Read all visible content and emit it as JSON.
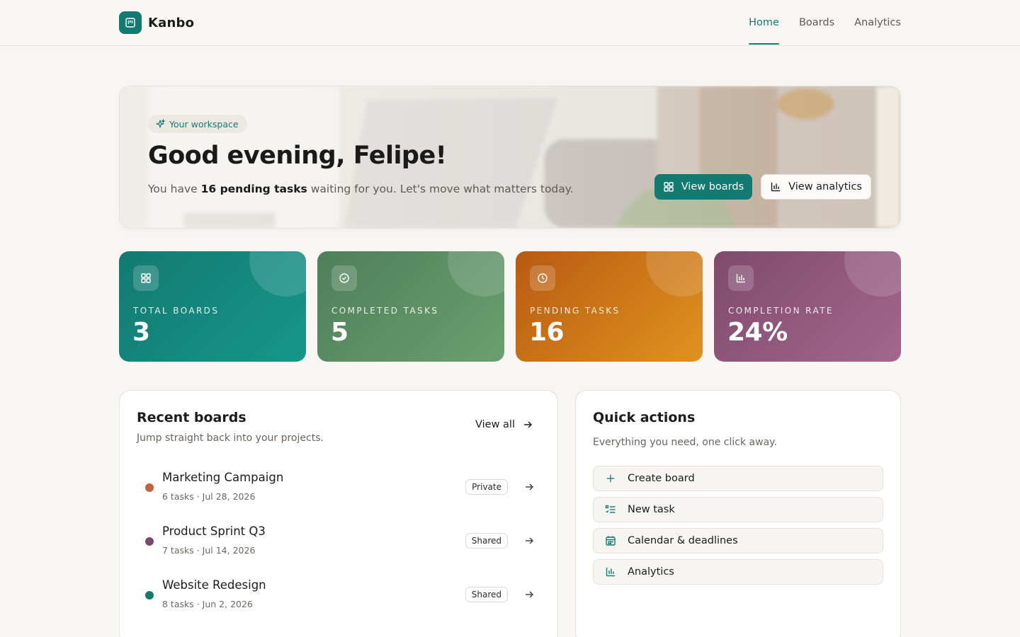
{
  "brand": {
    "name": "Kanbo",
    "logo_icon": "kanban-board-icon",
    "accent": "#137a72"
  },
  "nav": {
    "items": [
      {
        "label": "Home",
        "active": true
      },
      {
        "label": "Boards",
        "active": false
      },
      {
        "label": "Analytics",
        "active": false
      }
    ]
  },
  "hero": {
    "pill": "Your workspace",
    "pill_icon": "sparkles-icon",
    "title": "Good evening, Felipe!",
    "sub_prefix": "You have ",
    "sub_bold": "16 pending tasks",
    "sub_suffix": " waiting for you. Let's move what matters today.",
    "primary_button": {
      "label": "View boards",
      "icon": "grid-icon"
    },
    "secondary_button": {
      "label": "View analytics",
      "icon": "bar-chart-icon"
    }
  },
  "stats": [
    {
      "label": "TOTAL BOARDS",
      "value": "3",
      "icon": "grid-icon",
      "colors": [
        "#137a72",
        "#16968a"
      ]
    },
    {
      "label": "COMPLETED TASKS",
      "value": "5",
      "icon": "check-circle-icon",
      "colors": [
        "#4f7f5a",
        "#6aa06f"
      ]
    },
    {
      "label": "PENDING TASKS",
      "value": "16",
      "icon": "clock-icon",
      "colors": [
        "#b85a12",
        "#e0931f"
      ]
    },
    {
      "label": "COMPLETION RATE",
      "value": "24%",
      "icon": "bar-chart-icon",
      "colors": [
        "#7f4a6c",
        "#a4678d"
      ]
    }
  ],
  "recent_boards": {
    "title": "Recent boards",
    "subtitle": "Jump straight back into your projects.",
    "view_all": "View all",
    "items": [
      {
        "name": "Marketing Campaign",
        "meta": "6 tasks · Jul 28, 2026",
        "visibility": "Private",
        "color": "#c0643e"
      },
      {
        "name": "Product Sprint Q3",
        "meta": "7 tasks · Jul 14, 2026",
        "visibility": "Shared",
        "color": "#7a4a6a"
      },
      {
        "name": "Website Redesign",
        "meta": "8 tasks · Jun 2, 2026",
        "visibility": "Shared",
        "color": "#137a72"
      }
    ]
  },
  "quick_actions": {
    "title": "Quick actions",
    "subtitle": "Everything you need, one click away.",
    "items": [
      {
        "label": "Create board",
        "icon": "plus-icon"
      },
      {
        "label": "New task",
        "icon": "checklist-icon"
      },
      {
        "label": "Calendar & deadlines",
        "icon": "calendar-icon"
      },
      {
        "label": "Analytics",
        "icon": "bar-chart-icon"
      }
    ]
  }
}
